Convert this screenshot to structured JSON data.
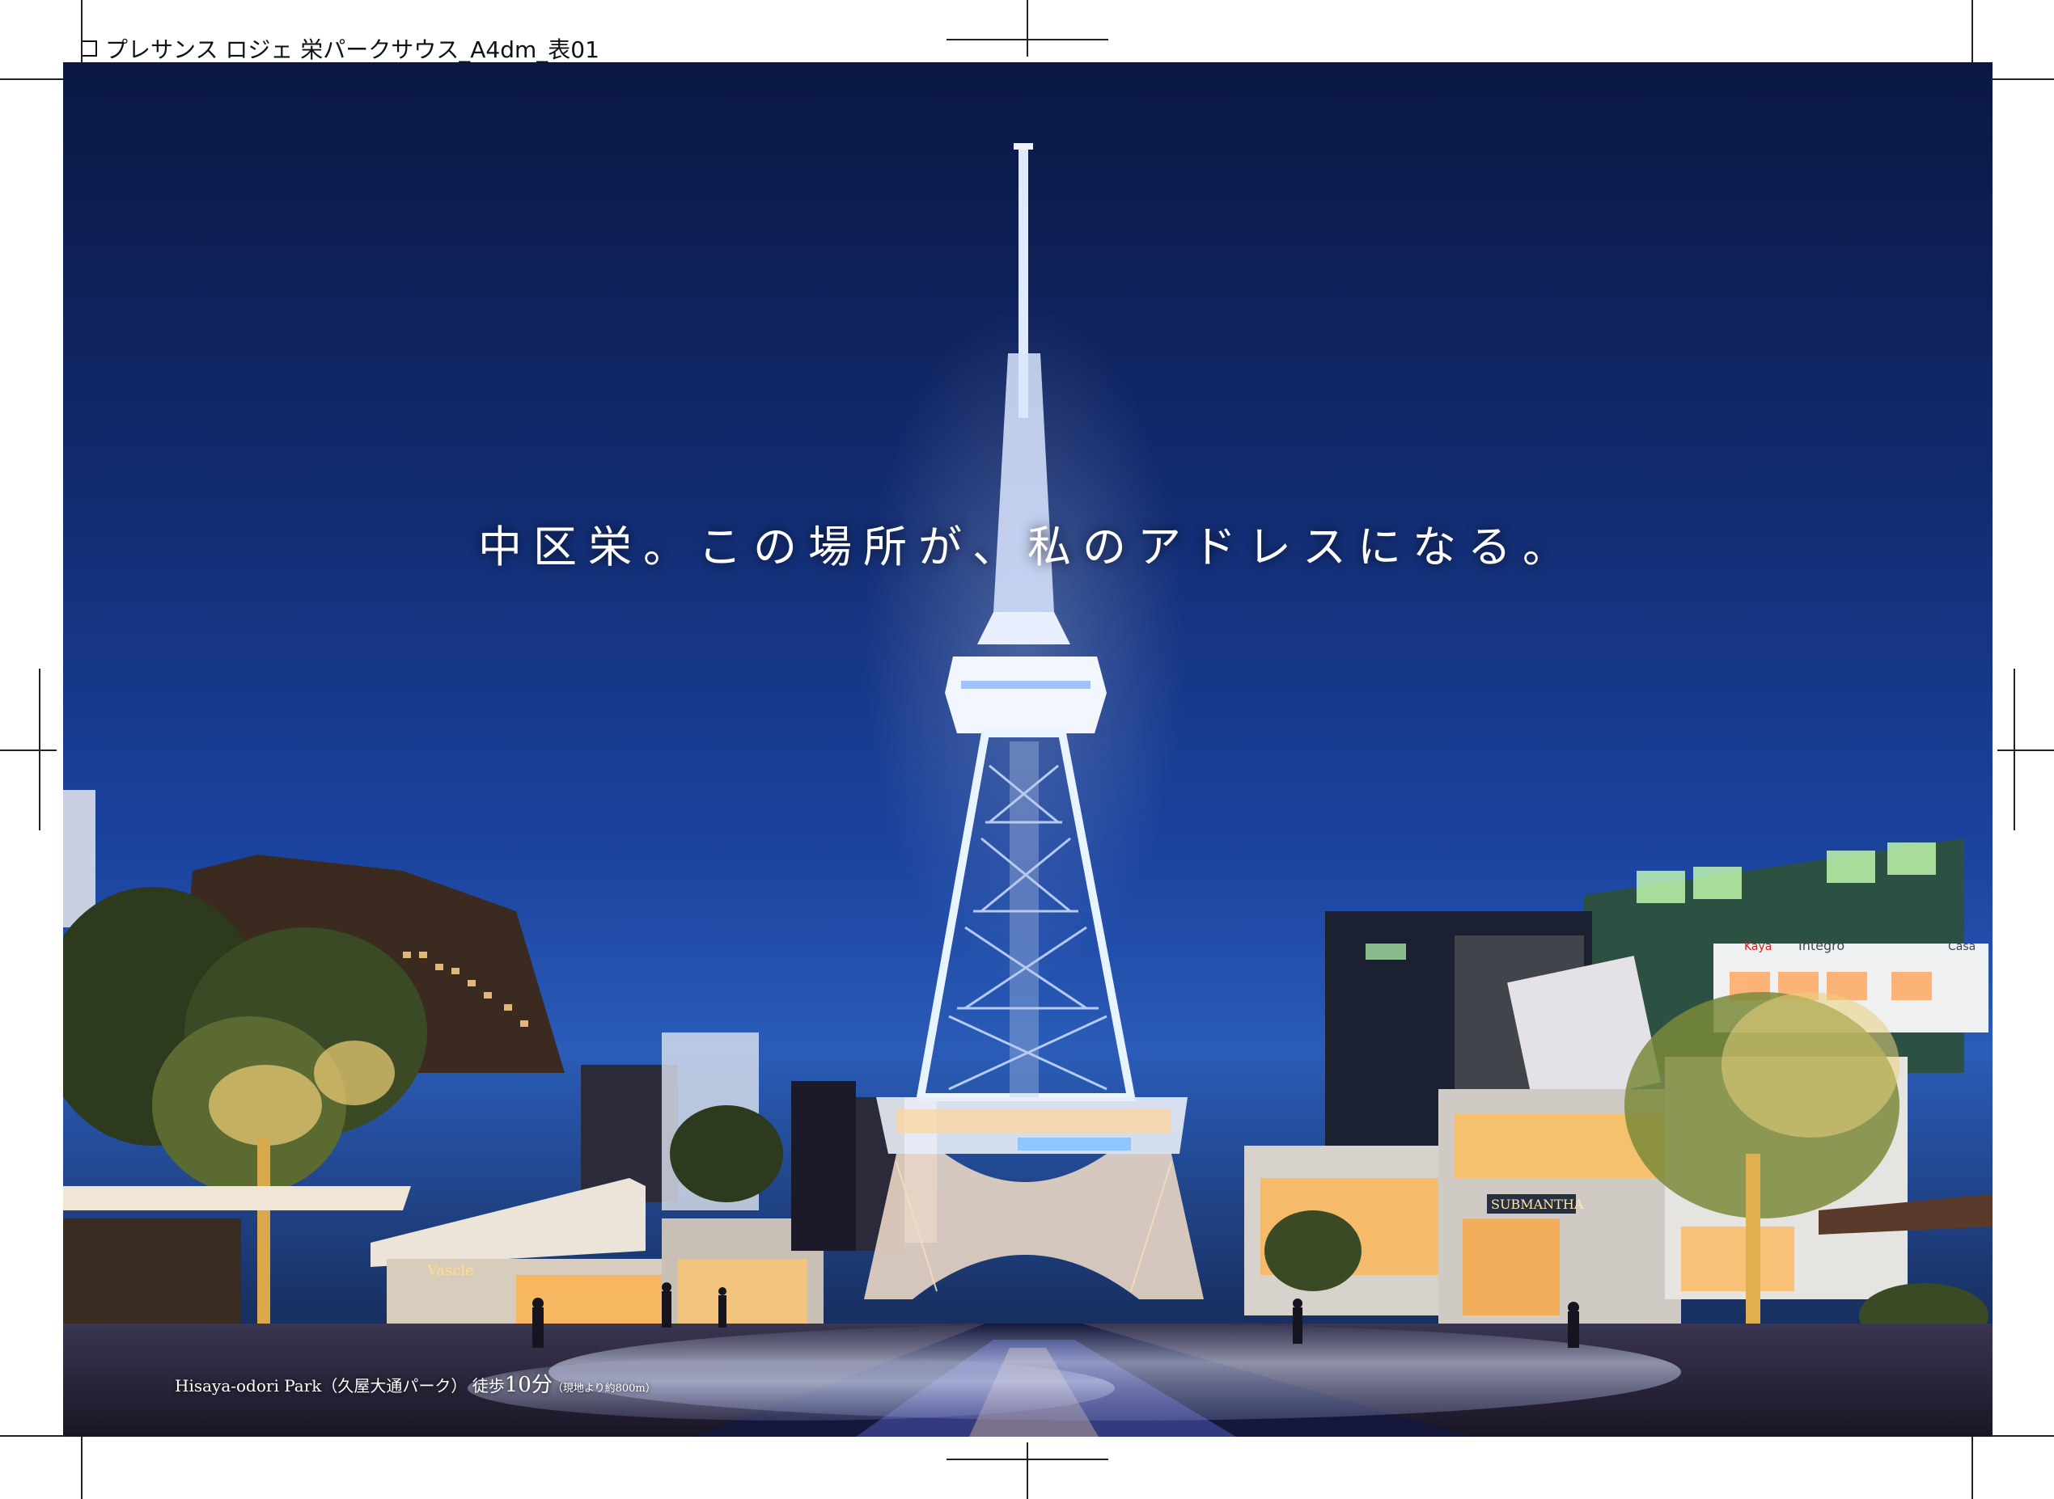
{
  "file_label": "プレサンス ロジェ 栄パークサウス_A4dm_表01",
  "headline": "中区栄。この場所が、私のアドレスになる。",
  "caption": {
    "park_name": "Hisaya-odori Park（久屋大通パーク）",
    "walk_label": "徒歩",
    "walk_time": "10分",
    "distance_note": "（現地より約800m）"
  },
  "signs": {
    "shop_1": "Vascle",
    "shop_2": "SUBMANTHA",
    "shop_3": "Integro",
    "shop_4": "Kaya",
    "shop_5": "Casa"
  },
  "colors": {
    "sky_top": "#0a1742",
    "sky_mid": "#1b44a0",
    "tower_light": "#e8f4ff",
    "warm_light": "#ffb24a"
  }
}
